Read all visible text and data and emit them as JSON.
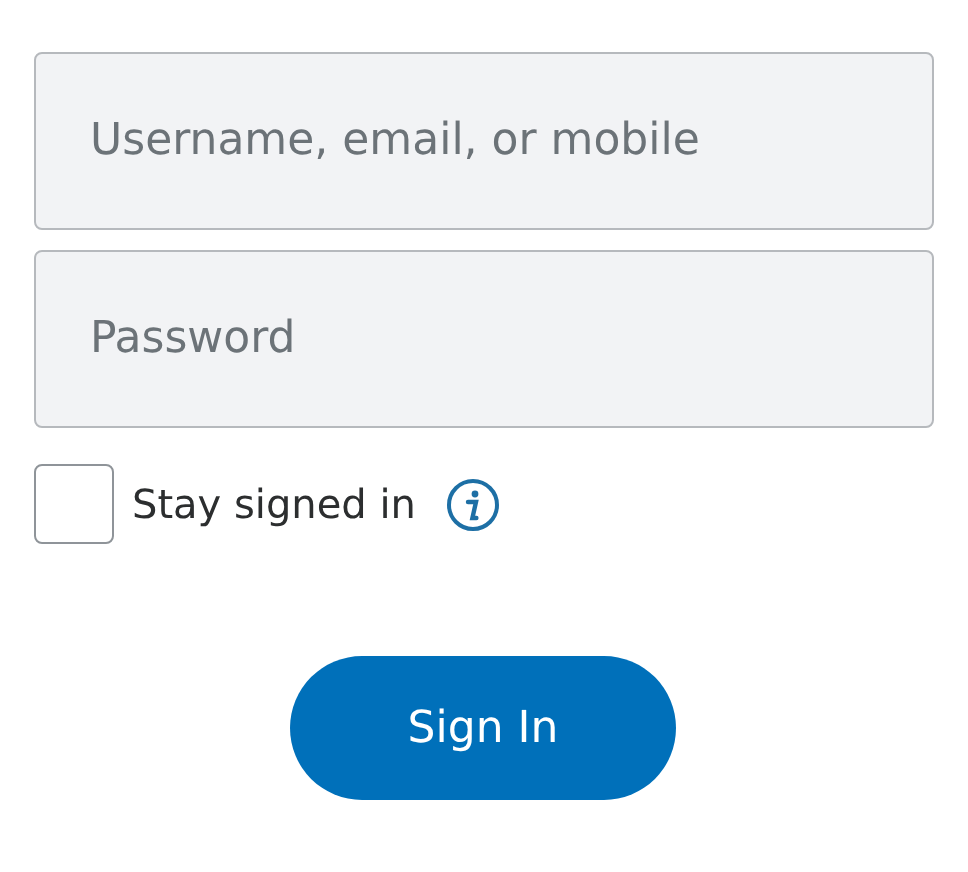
{
  "fields": [
    {
      "placeholder": "Username, email, or mobile"
    },
    {
      "placeholder": "Password"
    }
  ],
  "stay_signed_in": {
    "label": "Stay signed in",
    "checked": false
  },
  "button": {
    "label": "Sign In"
  }
}
